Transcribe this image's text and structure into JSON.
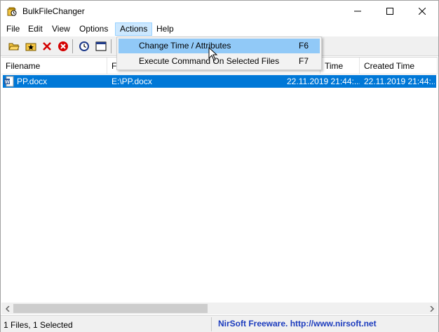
{
  "window": {
    "title": "BulkFileChanger",
    "icons": {
      "app": "app-icon",
      "minimize": "minimize-icon",
      "maximize": "maximize-icon",
      "close": "close-icon"
    }
  },
  "menu": {
    "items": [
      "File",
      "Edit",
      "View",
      "Options",
      "Actions",
      "Help"
    ],
    "active": "Actions"
  },
  "toolbar": {
    "buttons": [
      {
        "name": "add-files-button",
        "icon": "open-folder-icon"
      },
      {
        "name": "add-folder-button",
        "icon": "star-folder-icon"
      },
      {
        "name": "remove-button",
        "icon": "red-x-icon"
      },
      {
        "name": "clear-list-button",
        "icon": "red-circle-x-icon"
      },
      {
        "name": "change-time-button",
        "icon": "clock-icon"
      },
      {
        "name": "properties-button",
        "icon": "window-icon"
      }
    ]
  },
  "dropdown": {
    "items": [
      {
        "label": "Change Time / Attributes",
        "shortcut": "F6",
        "highlighted": true
      },
      {
        "label": "Execute Command On Selected Files",
        "shortcut": "F7",
        "highlighted": false
      }
    ]
  },
  "list": {
    "columns": [
      "Filename",
      "Full Path",
      "Modified Time",
      "Created Time"
    ],
    "visible_headers": {
      "filename": "Filename",
      "path_fragment": "F",
      "modified_fragment": "Time",
      "created": "Created Time"
    },
    "rows": [
      {
        "filename": "PP.docx",
        "path": "E:\\PP.docx",
        "modified": "22.11.2019 21:44:...",
        "created": "22.11.2019 21:44:...",
        "selected": true,
        "icon": "word-document-icon"
      }
    ]
  },
  "status": {
    "left": "1 Files, 1 Selected",
    "right": "NirSoft Freeware.  http://www.nirsoft.net"
  },
  "colors": {
    "selection": "#0078d7",
    "menu_active": "#cce8ff",
    "dropdown_hover": "#91c9f7",
    "nirsoft_link": "#1c3cbe"
  }
}
